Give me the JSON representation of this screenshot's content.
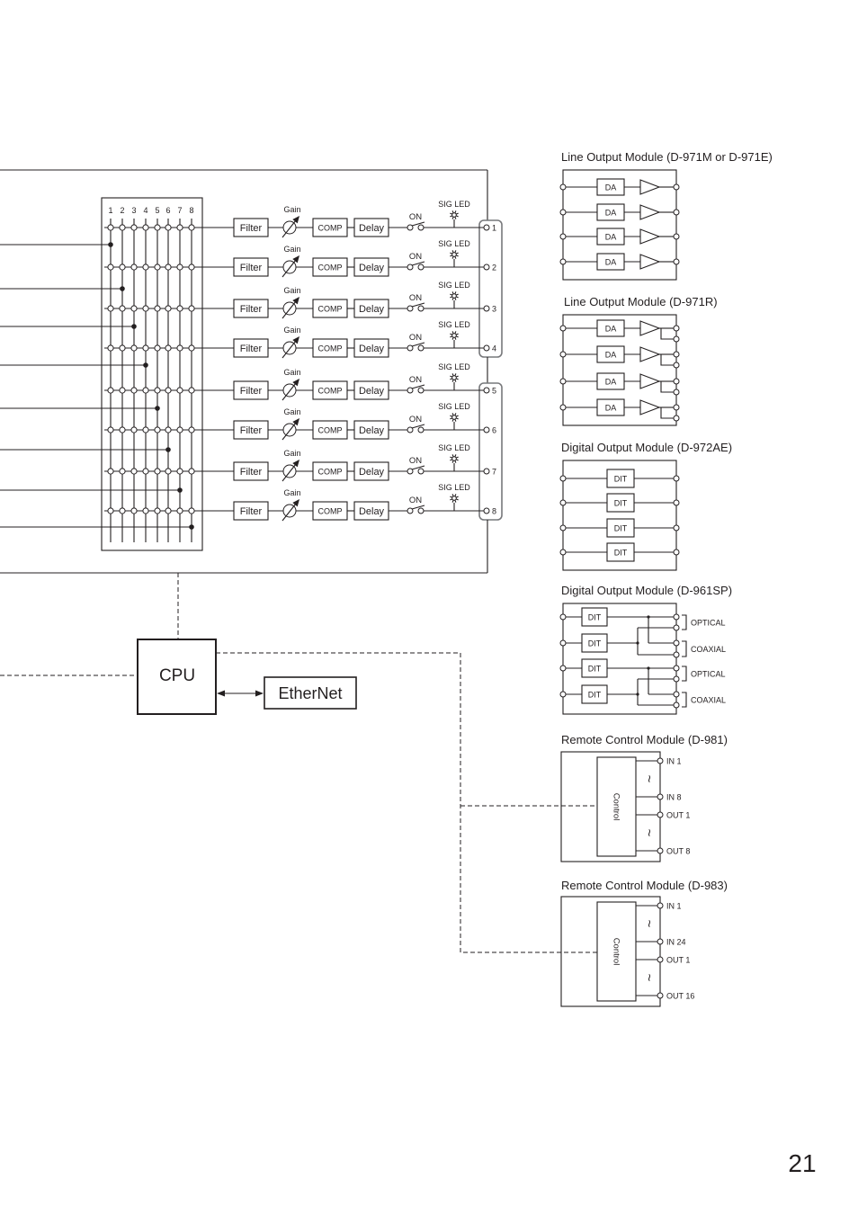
{
  "page": {
    "number": "21"
  },
  "matrix": {
    "column_labels": [
      "1",
      "2",
      "3",
      "4",
      "5",
      "6",
      "7",
      "8"
    ],
    "inputs": [
      {
        "column": 1
      },
      {
        "column": 2
      },
      {
        "column": 3
      },
      {
        "column": 4
      },
      {
        "column": 5
      },
      {
        "column": 6
      },
      {
        "column": 7
      },
      {
        "column": 8
      }
    ]
  },
  "channels": [
    {
      "filter": "Filter",
      "gain": "Gain",
      "comp": "COMP",
      "delay": "Delay",
      "switch": "ON",
      "led": "SIG LED",
      "output": "1"
    },
    {
      "filter": "Filter",
      "gain": "Gain",
      "comp": "COMP",
      "delay": "Delay",
      "switch": "ON",
      "led": "SIG LED",
      "output": "2"
    },
    {
      "filter": "Filter",
      "gain": "Gain",
      "comp": "COMP",
      "delay": "Delay",
      "switch": "ON",
      "led": "SIG LED",
      "output": "3"
    },
    {
      "filter": "Filter",
      "gain": "Gain",
      "comp": "COMP",
      "delay": "Delay",
      "switch": "ON",
      "led": "SIG LED",
      "output": "4"
    },
    {
      "filter": "Filter",
      "gain": "Gain",
      "comp": "COMP",
      "delay": "Delay",
      "switch": "ON",
      "led": "SIG LED",
      "output": "5"
    },
    {
      "filter": "Filter",
      "gain": "Gain",
      "comp": "COMP",
      "delay": "Delay",
      "switch": "ON",
      "led": "SIG LED",
      "output": "6"
    },
    {
      "filter": "Filter",
      "gain": "Gain",
      "comp": "COMP",
      "delay": "Delay",
      "switch": "ON",
      "led": "SIG LED",
      "output": "7"
    },
    {
      "filter": "Filter",
      "gain": "Gain",
      "comp": "COMP",
      "delay": "Delay",
      "switch": "ON",
      "led": "SIG LED",
      "output": "8"
    }
  ],
  "cpu": {
    "label": "CPU"
  },
  "ethernet": {
    "label": "EtherNet"
  },
  "modules": {
    "line_output_m": {
      "title": "Line Output Module (D-971M or D-971E)",
      "blocks": [
        "DA",
        "DA",
        "DA",
        "DA"
      ]
    },
    "line_output_r": {
      "title": "Line Output Module (D-971R)",
      "blocks": [
        "DA",
        "DA",
        "DA",
        "DA"
      ]
    },
    "digital_output_ae": {
      "title": "Digital Output Module (D-972AE)",
      "blocks": [
        "DIT",
        "DIT",
        "DIT",
        "DIT"
      ]
    },
    "digital_output_sp": {
      "title": "Digital Output Module (D-961SP)",
      "blocks": [
        "DIT",
        "DIT",
        "DIT",
        "DIT"
      ],
      "connectors": [
        "OPTICAL",
        "COAXIAL",
        "OPTICAL",
        "COAXIAL"
      ]
    },
    "remote_981": {
      "title": "Remote Control Module (D-981)",
      "control": "Control",
      "terminals": [
        "IN 1",
        "IN 8",
        "OUT 1",
        "OUT 8"
      ],
      "range_mark": "~"
    },
    "remote_983": {
      "title": "Remote Control Module (D-983)",
      "control": "Control",
      "terminals": [
        "IN 1",
        "IN 24",
        "OUT 1",
        "OUT 16"
      ],
      "range_mark": "~"
    }
  }
}
